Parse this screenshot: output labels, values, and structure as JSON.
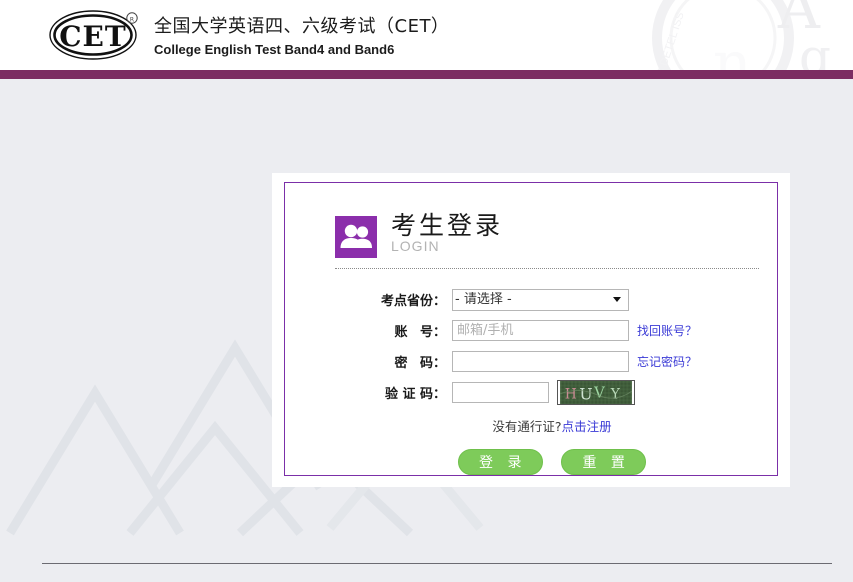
{
  "header": {
    "logo_text": "CET",
    "logo_trademark": "®",
    "title_cn": "全国大学英语四、六级考试（CET）",
    "title_en": "College English Test Band4 and Band6",
    "bar_color": "#7c2d62"
  },
  "panel": {
    "heading_cn": "考生登录",
    "heading_en": "LOGIN",
    "icon_color": "#8b2eab",
    "border_color": "#7b2fa8"
  },
  "form": {
    "province": {
      "label": "考点省份：",
      "selected": "- 请选择 -",
      "options": [
        "- 请选择 -"
      ]
    },
    "account": {
      "label_char1": "账",
      "label_char2": "号：",
      "label": "账　　号：",
      "value": "",
      "placeholder": "邮箱/手机",
      "link": "找回账号？"
    },
    "password": {
      "label_char1": "密",
      "label_char2": "码：",
      "label": "密　　码：",
      "value": "",
      "placeholder": "",
      "link": "忘记密码？"
    },
    "captcha": {
      "label": "验 证 码：",
      "value": "",
      "placeholder": "",
      "image_text": "HUVY",
      "image_chars": [
        "H",
        "U",
        "V",
        "Y"
      ]
    },
    "register": {
      "prefix": "没有通行证?",
      "link": "点击注册"
    },
    "buttons": {
      "submit": "登 录",
      "reset": "重 置",
      "color": "#7ecb5a"
    }
  },
  "page": {
    "background_color": "#ecedf1",
    "accent_link_color": "#3a3ad6"
  }
}
